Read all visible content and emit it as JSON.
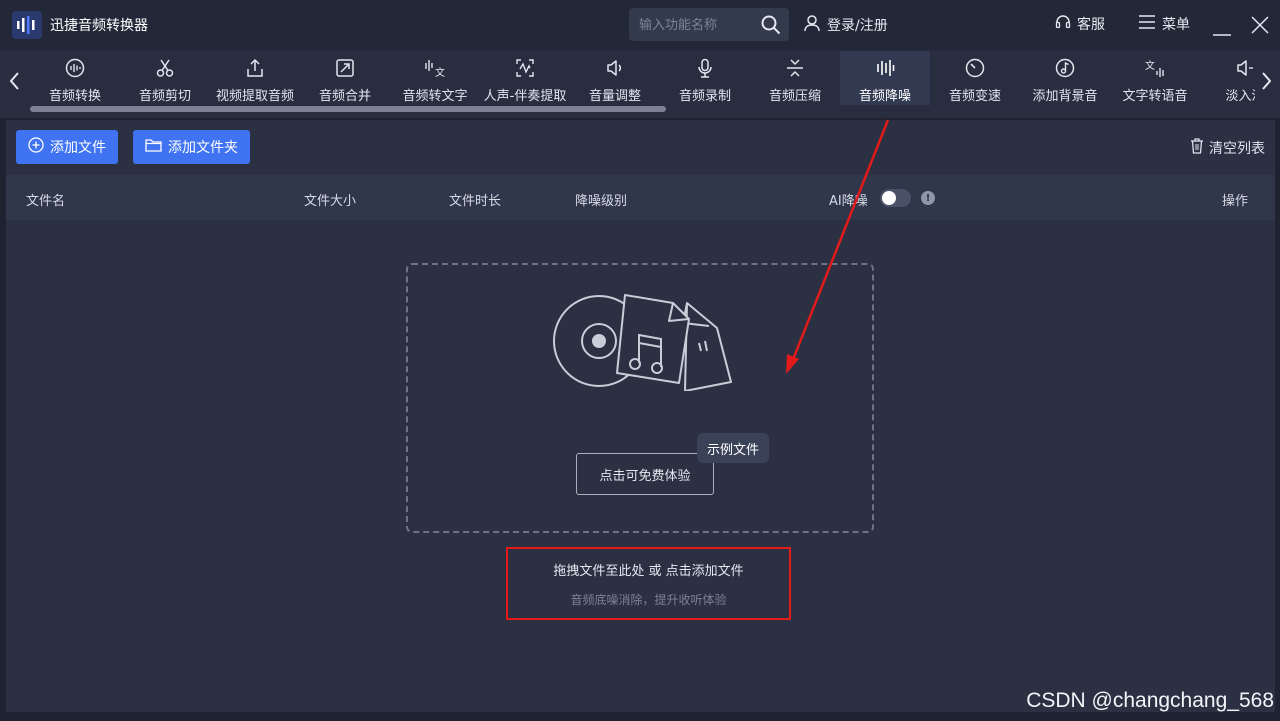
{
  "app": {
    "title": "迅捷音频转换器"
  },
  "search": {
    "placeholder": "输入功能名称"
  },
  "titlebar": {
    "login": "登录/注册",
    "service": "客服",
    "menu": "菜单"
  },
  "tools": [
    {
      "label": "音频转换",
      "icon": "audio-convert-icon",
      "active": false
    },
    {
      "label": "音频剪切",
      "icon": "scissors-icon",
      "active": false
    },
    {
      "label": "视频提取音频",
      "icon": "upload-icon",
      "active": false
    },
    {
      "label": "音频合并",
      "icon": "merge-icon",
      "active": false
    },
    {
      "label": "音频转文字",
      "icon": "audio-to-text-icon",
      "active": false
    },
    {
      "label": "人声-伴奏提取",
      "icon": "wave-extract-icon",
      "active": false
    },
    {
      "label": "音量调整",
      "icon": "speaker-icon",
      "active": false
    },
    {
      "label": "音频录制",
      "icon": "microphone-icon",
      "active": false
    },
    {
      "label": "音频压缩",
      "icon": "compress-icon",
      "active": false
    },
    {
      "label": "音频降噪",
      "icon": "equalizer-icon",
      "active": true
    },
    {
      "label": "音频变速",
      "icon": "speed-dial-icon",
      "active": false
    },
    {
      "label": "添加背景音",
      "icon": "music-note-icon",
      "active": false
    },
    {
      "label": "文字转语音",
      "icon": "text-to-speech-icon",
      "active": false
    },
    {
      "label": "淡入淡",
      "icon": "fade-icon",
      "active": false
    }
  ],
  "actions": {
    "add_file": "添加文件",
    "add_folder": "添加文件夹",
    "clear_list": "清空列表"
  },
  "table": {
    "col_name": "文件名",
    "col_size": "文件大小",
    "col_duration": "文件时长",
    "col_level": "降噪级别",
    "col_ai": "AI降噪",
    "col_ops": "操作",
    "ai_toggle_on": false
  },
  "dropzone": {
    "try_button": "点击可免费体验",
    "sample_tag": "示例文件",
    "hint_main": "拖拽文件至此处 或 点击添加文件",
    "hint_sub": "音频底噪消除，提升收听体验"
  },
  "watermark": "CSDN @changchang_568",
  "colors": {
    "accent": "#3f73f2",
    "annotation": "#e21a1a",
    "background": "#2b3043"
  }
}
